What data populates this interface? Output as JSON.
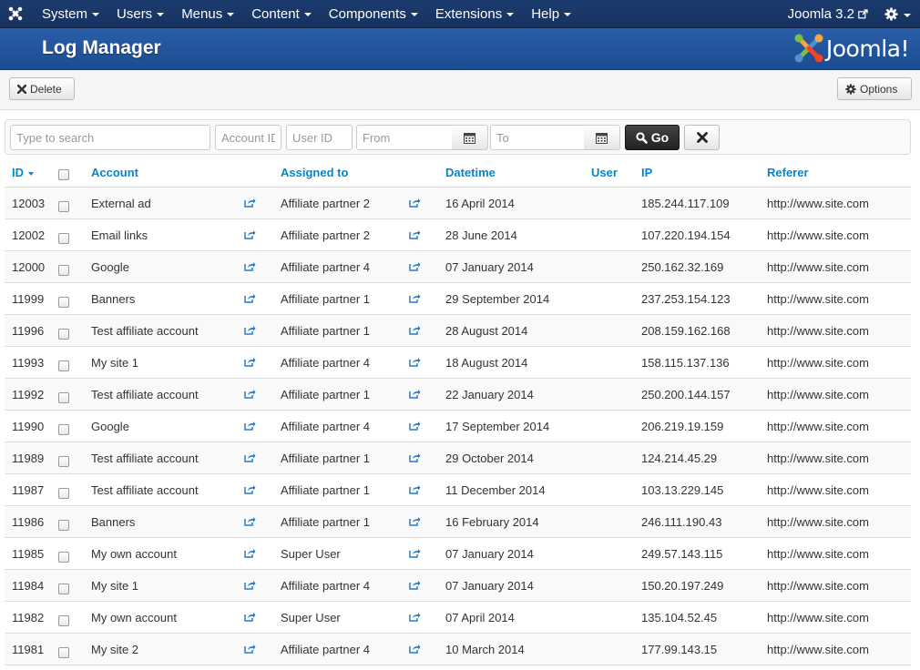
{
  "navbar": {
    "menu": [
      "System",
      "Users",
      "Menus",
      "Content",
      "Components",
      "Extensions",
      "Help"
    ],
    "site_label": "Joomla 3.2"
  },
  "header": {
    "title": "Log Manager",
    "brand": "Joomla!"
  },
  "toolbar": {
    "delete_label": "Delete",
    "options_label": "Options"
  },
  "filters": {
    "search_placeholder": "Type to search",
    "account_placeholder": "Account ID",
    "user_placeholder": "User ID",
    "from_placeholder": "From",
    "to_placeholder": "To",
    "go_label": "Go"
  },
  "table": {
    "columns": [
      "ID",
      "Account",
      "Assigned to",
      "Datetime",
      "User",
      "IP",
      "Referer"
    ],
    "rows": [
      {
        "id": "12003",
        "account": "External ad",
        "assigned": "Affiliate partner 2",
        "datetime": "16 April 2014",
        "user": "",
        "ip": "185.244.117.109",
        "referer": "http://www.site.com"
      },
      {
        "id": "12002",
        "account": "Email links",
        "assigned": "Affiliate partner 2",
        "datetime": "28 June 2014",
        "user": "",
        "ip": "107.220.194.154",
        "referer": "http://www.site.com"
      },
      {
        "id": "12000",
        "account": "Google",
        "assigned": "Affiliate partner 4",
        "datetime": "07 January 2014",
        "user": "",
        "ip": "250.162.32.169",
        "referer": "http://www.site.com"
      },
      {
        "id": "11999",
        "account": "Banners",
        "assigned": "Affiliate partner 1",
        "datetime": "29 September 2014",
        "user": "",
        "ip": "237.253.154.123",
        "referer": "http://www.site.com"
      },
      {
        "id": "11996",
        "account": "Test affiliate account",
        "assigned": "Affiliate partner 1",
        "datetime": "28 August 2014",
        "user": "",
        "ip": "208.159.162.168",
        "referer": "http://www.site.com"
      },
      {
        "id": "11993",
        "account": "My site 1",
        "assigned": "Affiliate partner 4",
        "datetime": "18 August 2014",
        "user": "",
        "ip": "158.115.137.136",
        "referer": "http://www.site.com"
      },
      {
        "id": "11992",
        "account": "Test affiliate account",
        "assigned": "Affiliate partner 1",
        "datetime": "22 January 2014",
        "user": "",
        "ip": "250.200.144.157",
        "referer": "http://www.site.com"
      },
      {
        "id": "11990",
        "account": "Google",
        "assigned": "Affiliate partner 4",
        "datetime": "17 September 2014",
        "user": "",
        "ip": "206.219.19.159",
        "referer": "http://www.site.com"
      },
      {
        "id": "11989",
        "account": "Test affiliate account",
        "assigned": "Affiliate partner 1",
        "datetime": "29 October 2014",
        "user": "",
        "ip": "124.214.45.29",
        "referer": "http://www.site.com"
      },
      {
        "id": "11987",
        "account": "Test affiliate account",
        "assigned": "Affiliate partner 1",
        "datetime": "11 December 2014",
        "user": "",
        "ip": "103.13.229.145",
        "referer": "http://www.site.com"
      },
      {
        "id": "11986",
        "account": "Banners",
        "assigned": "Affiliate partner 1",
        "datetime": "16 February 2014",
        "user": "",
        "ip": "246.111.190.43",
        "referer": "http://www.site.com"
      },
      {
        "id": "11985",
        "account": "My own account",
        "assigned": "Super User",
        "datetime": "07 January 2014",
        "user": "",
        "ip": "249.57.143.115",
        "referer": "http://www.site.com"
      },
      {
        "id": "11984",
        "account": "My site 1",
        "assigned": "Affiliate partner 4",
        "datetime": "07 January 2014",
        "user": "",
        "ip": "150.20.197.249",
        "referer": "http://www.site.com"
      },
      {
        "id": "11982",
        "account": "My own account",
        "assigned": "Super User",
        "datetime": "07 April 2014",
        "user": "",
        "ip": "135.104.52.45",
        "referer": "http://www.site.com"
      },
      {
        "id": "11981",
        "account": "My site 2",
        "assigned": "Affiliate partner 4",
        "datetime": "10 March 2014",
        "user": "",
        "ip": "177.99.143.15",
        "referer": "http://www.site.com"
      }
    ]
  },
  "colors": {
    "navbar": "#1b3b6f",
    "header": "#2a5ea9",
    "link": "#0088cc"
  }
}
